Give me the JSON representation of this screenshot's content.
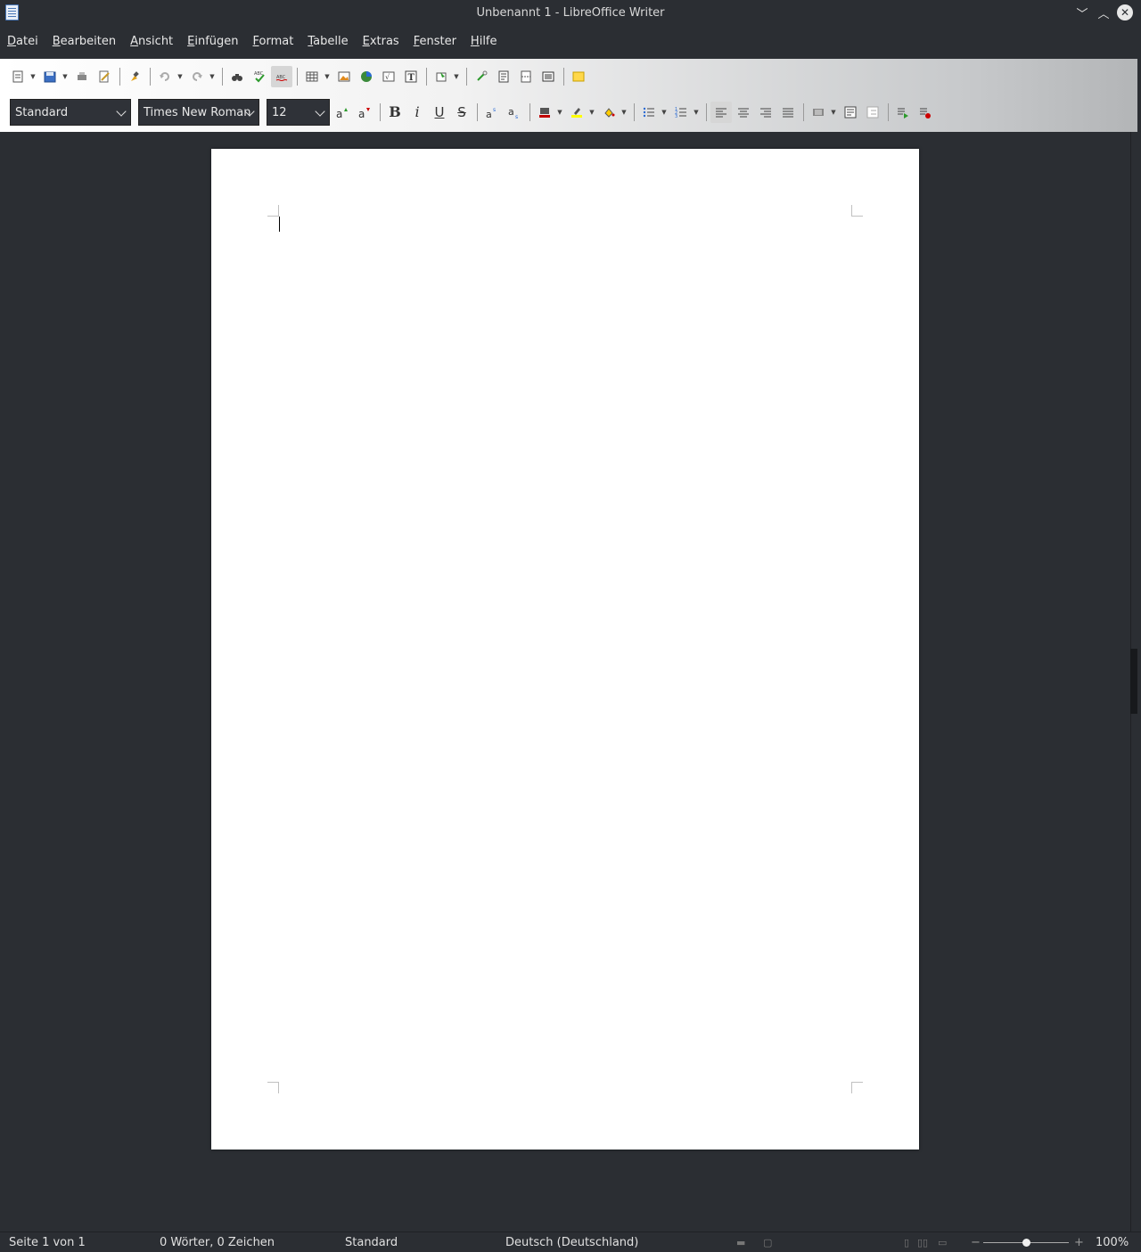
{
  "window": {
    "title": "Unbenannt 1 - LibreOffice Writer"
  },
  "menubar": {
    "items": [
      {
        "label": "Datei",
        "mnemonic": "D",
        "rest": "atei"
      },
      {
        "label": "Bearbeiten",
        "mnemonic": "B",
        "rest": "earbeiten"
      },
      {
        "label": "Ansicht",
        "mnemonic": "A",
        "rest": "nsicht"
      },
      {
        "label": "Einfügen",
        "mnemonic": "E",
        "rest": "infügen"
      },
      {
        "label": "Format",
        "mnemonic": "F",
        "rest": "ormat"
      },
      {
        "label": "Tabelle",
        "mnemonic": "T",
        "rest": "abelle"
      },
      {
        "label": "Extras",
        "mnemonic": "E",
        "rest": "xtras"
      },
      {
        "label": "Fenster",
        "mnemonic": "F",
        "rest": "enster"
      },
      {
        "label": "Hilfe",
        "mnemonic": "H",
        "rest": "ilfe"
      }
    ]
  },
  "formatting": {
    "paragraph_style": "Standard",
    "font_name": "Times New Roman",
    "font_size": "12",
    "bold_glyph": "B",
    "italic_glyph": "i",
    "underline_glyph": "U",
    "strike_glyph": "S"
  },
  "statusbar": {
    "page": "Seite 1 von 1",
    "words": "0 Wörter, 0 Zeichen",
    "page_style": "Standard",
    "language": "Deutsch (Deutschland)",
    "zoom": "100%",
    "zoom_minus": "−",
    "zoom_plus": "+"
  },
  "document": {
    "text": ""
  },
  "colors": {
    "font_color": "#c00000",
    "highlight": "#ffff00",
    "accent": "#2a6ad4"
  }
}
